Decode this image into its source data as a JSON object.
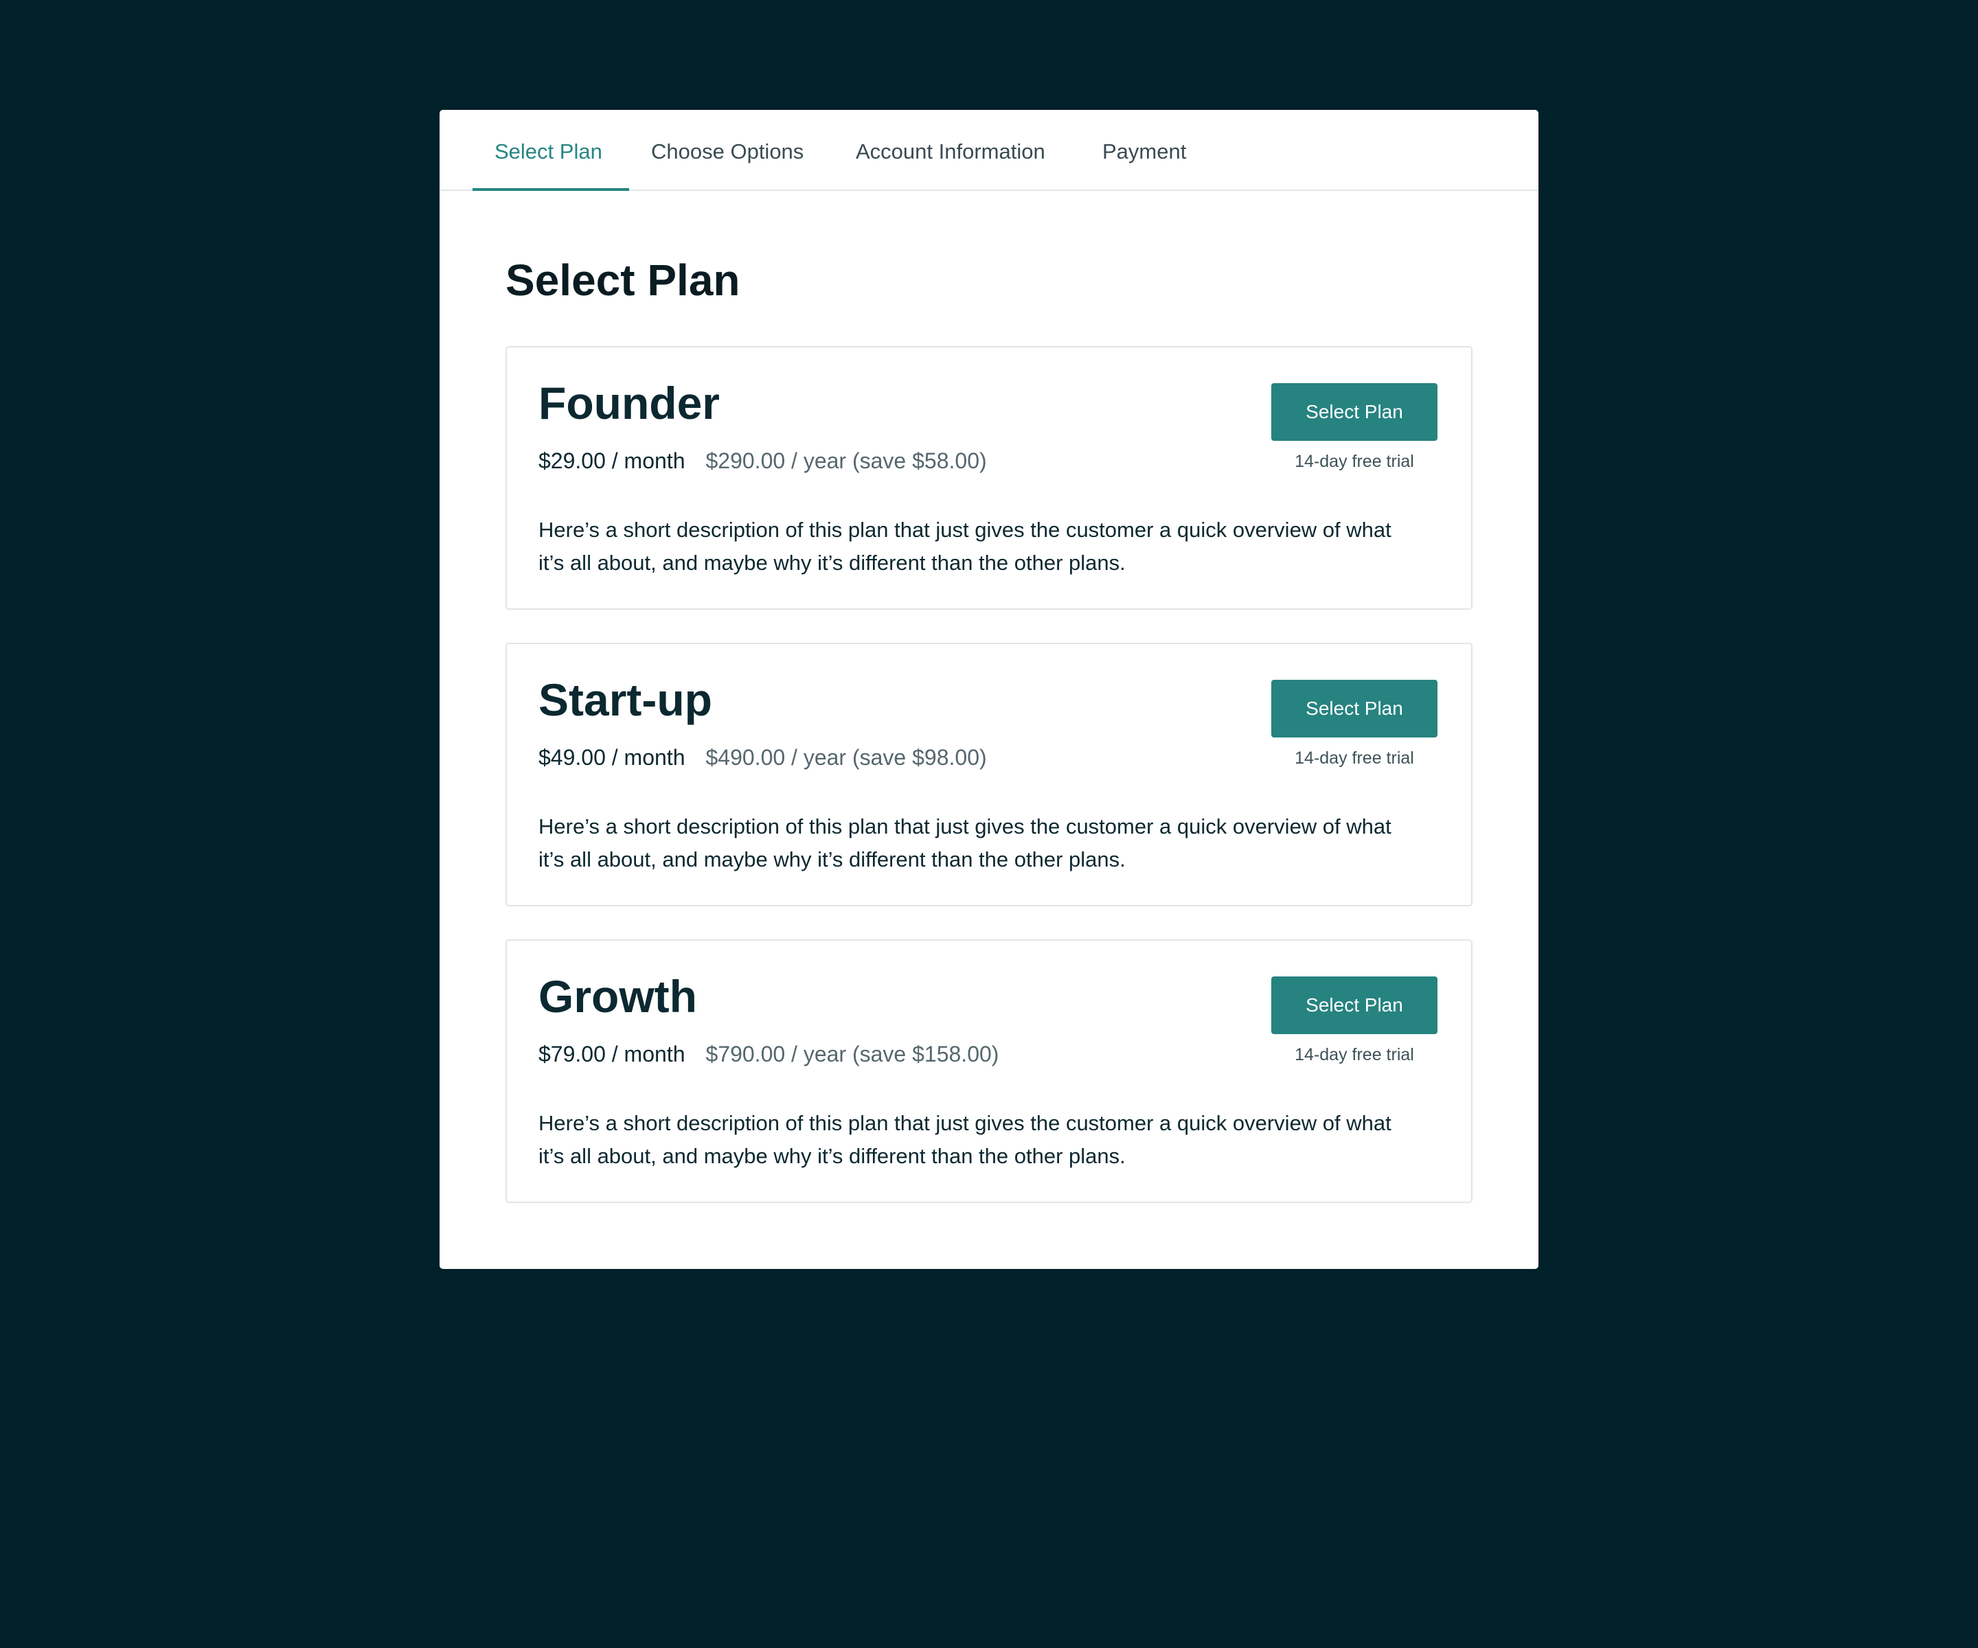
{
  "tabs": [
    {
      "label": "Select Plan",
      "active": true
    },
    {
      "label": "Choose Options",
      "active": false
    },
    {
      "label": "Account Information",
      "active": false
    },
    {
      "label": "Payment",
      "active": false
    }
  ],
  "page_title": "Select Plan",
  "plans": [
    {
      "name": "Founder",
      "price_month": "$29.00 / month",
      "price_year": "$290.00 / year (save $58.00)",
      "button_label": "Select Plan",
      "trial": "14-day free trial",
      "description": "Here’s a short description of this plan that just gives the customer a quick overview of what it’s all about, and maybe why it’s different than the other plans."
    },
    {
      "name": "Start-up",
      "price_month": "$49.00 / month",
      "price_year": "$490.00 / year (save $98.00)",
      "button_label": "Select Plan",
      "trial": "14-day free trial",
      "description": "Here’s a short description of this plan that just gives the customer a quick overview of what it’s all about, and maybe why it’s different than the other plans."
    },
    {
      "name": "Growth",
      "price_month": "$79.00 / month",
      "price_year": "$790.00 / year (save $158.00)",
      "button_label": "Select Plan",
      "trial": "14-day free trial",
      "description": "Here’s a short description of this plan that just gives the customer a quick overview of what it’s all about, and maybe why it’s different than the other plans."
    }
  ],
  "colors": {
    "background": "#00202a",
    "accent": "#268380",
    "text": "#0c2830",
    "muted": "#56676d"
  }
}
